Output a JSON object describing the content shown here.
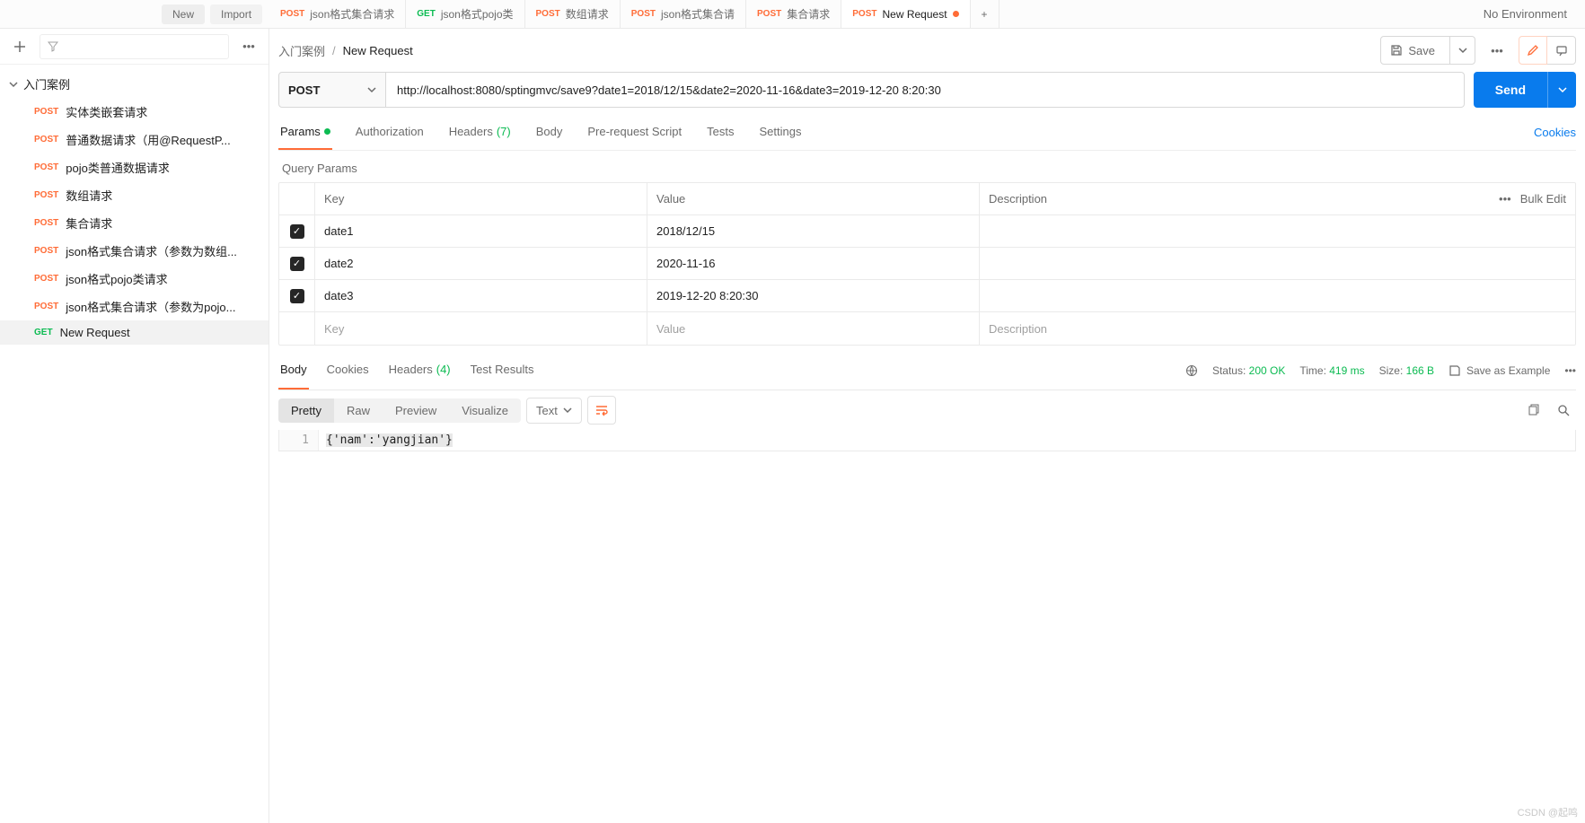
{
  "toolbar": {
    "new": "New",
    "import": "Import"
  },
  "tabs": [
    {
      "method": "POST",
      "label": "json格式集合请求"
    },
    {
      "method": "GET",
      "label": "json格式pojo类"
    },
    {
      "method": "POST",
      "label": "数组请求"
    },
    {
      "method": "POST",
      "label": "json格式集合请"
    },
    {
      "method": "POST",
      "label": "集合请求"
    },
    {
      "method": "POST",
      "label": "New Request",
      "active": true,
      "dirty": true
    },
    {
      "method": "",
      "label": "+"
    }
  ],
  "env": "No Environment",
  "sidebar": {
    "folder": "入门案例",
    "items": [
      {
        "method": "POST",
        "label": "实体类嵌套请求"
      },
      {
        "method": "POST",
        "label": "普通数据请求（用@RequestP..."
      },
      {
        "method": "POST",
        "label": "pojo类普通数据请求"
      },
      {
        "method": "POST",
        "label": "数组请求"
      },
      {
        "method": "POST",
        "label": "集合请求"
      },
      {
        "method": "POST",
        "label": "json格式集合请求（参数为数组..."
      },
      {
        "method": "POST",
        "label": "json格式pojo类请求"
      },
      {
        "method": "POST",
        "label": "json格式集合请求（参数为pojo..."
      },
      {
        "method": "GET",
        "label": "New Request",
        "active": true
      }
    ]
  },
  "breadcrumb": {
    "root": "入门案例",
    "title": "New Request"
  },
  "actions": {
    "save": "Save"
  },
  "request": {
    "method": "POST",
    "url": "http://localhost:8080/sptingmvc/save9?date1=2018/12/15&date2=2020-11-16&date3=2019-12-20 8:20:30",
    "send": "Send"
  },
  "reqTabs": {
    "params": "Params",
    "auth": "Authorization",
    "headers": "Headers",
    "headersCount": "(7)",
    "body": "Body",
    "prereq": "Pre-request Script",
    "tests": "Tests",
    "settings": "Settings",
    "cookies": "Cookies"
  },
  "params": {
    "title": "Query Params",
    "cols": {
      "key": "Key",
      "value": "Value",
      "desc": "Description",
      "bulk": "Bulk Edit"
    },
    "rows": [
      {
        "key": "date1",
        "value": "2018/12/15"
      },
      {
        "key": "date2",
        "value": "2020-11-16"
      },
      {
        "key": "date3",
        "value": "2019-12-20 8:20:30"
      }
    ],
    "placeholder": {
      "key": "Key",
      "value": "Value",
      "desc": "Description"
    }
  },
  "resp": {
    "tabs": {
      "body": "Body",
      "cookies": "Cookies",
      "headers": "Headers",
      "headersCount": "(4)",
      "tests": "Test Results"
    },
    "status": {
      "label": "Status:",
      "value": "200 OK"
    },
    "time": {
      "label": "Time:",
      "value": "419 ms"
    },
    "size": {
      "label": "Size:",
      "value": "166 B"
    },
    "saveAs": "Save as Example",
    "views": {
      "pretty": "Pretty",
      "raw": "Raw",
      "preview": "Preview",
      "visualize": "Visualize"
    },
    "type": "Text",
    "body": "{'nam':'yangjian'}",
    "lineNo": "1"
  },
  "watermark": "CSDN @起鸣"
}
